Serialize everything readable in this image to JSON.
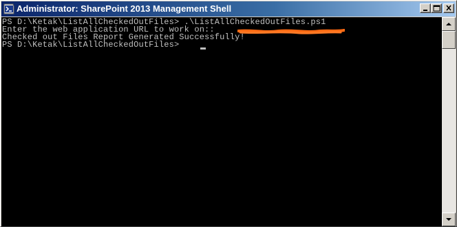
{
  "window": {
    "title": "Administrator: SharePoint 2013 Management Shell",
    "app_icon": "powershell-icon",
    "controls": {
      "minimize_icon": "minimize-icon",
      "maximize_icon": "maximize-icon",
      "close_icon": "close-icon"
    }
  },
  "console": {
    "background": "#000000",
    "foreground": "#c0c0c0",
    "redaction_color": "#ff6a13",
    "lines": [
      "PS D:\\Ketak\\ListAllCheckedOutFiles> .\\ListAllCheckedOutFiles.ps1",
      "Enter the web application URL to work on:: ",
      "Checked out Files Report Generated Successfully!",
      "PS D:\\Ketak\\ListAllCheckedOutFiles> "
    ]
  },
  "scrollbar": {
    "up_icon": "scroll-up-arrow-icon",
    "down_icon": "scroll-down-arrow-icon"
  }
}
